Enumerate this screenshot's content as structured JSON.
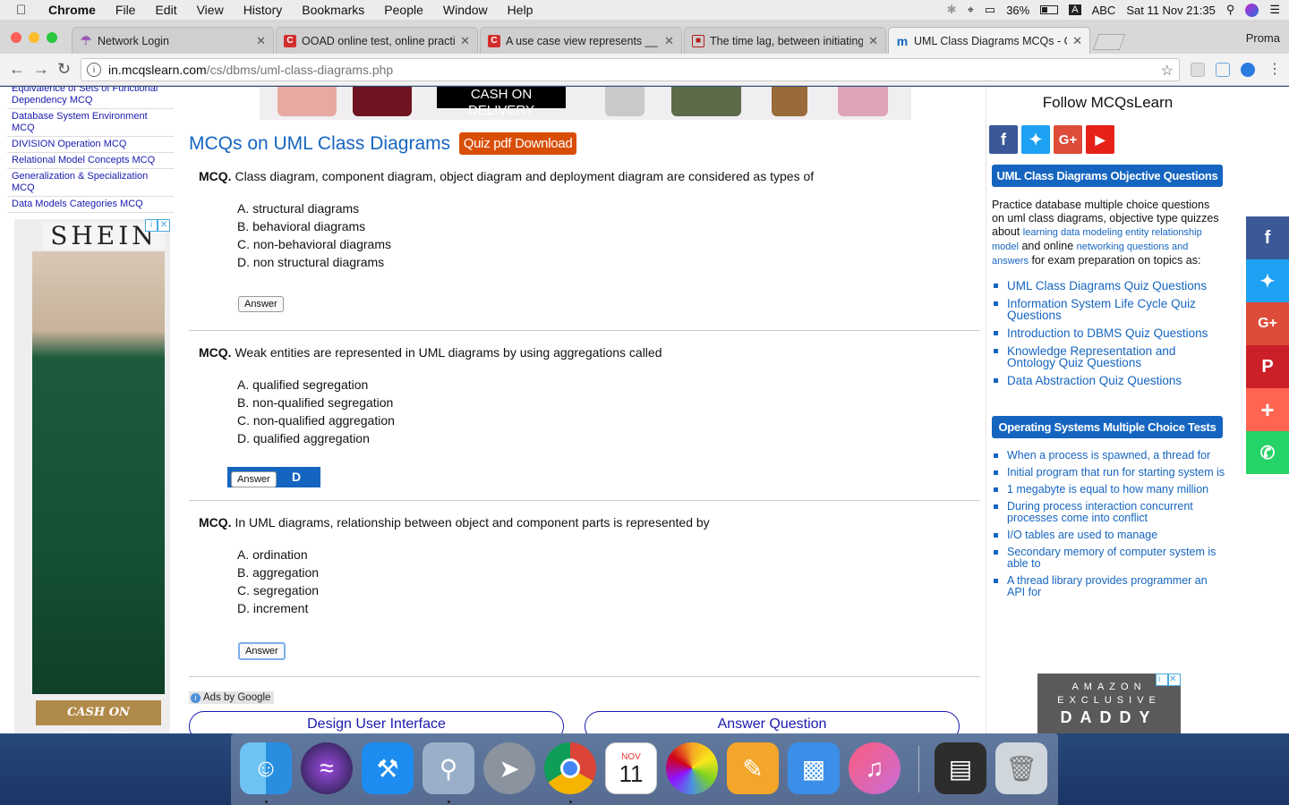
{
  "menubar": {
    "app": "Chrome",
    "items": [
      "File",
      "Edit",
      "View",
      "History",
      "Bookmarks",
      "People",
      "Window",
      "Help"
    ],
    "battery": "36%",
    "input_source": "ABC",
    "clock": "Sat 11 Nov  21:35"
  },
  "tabs": [
    {
      "title": "Network Login",
      "icon": "network-login-icon",
      "color": "#9b59b6"
    },
    {
      "title": "OOAD online test, online practi",
      "icon": "c-site-icon",
      "color": "#d32f2f"
    },
    {
      "title": "A use case view represents __",
      "icon": "c-site-icon",
      "color": "#d32f2f"
    },
    {
      "title": "The time lag, between initiating",
      "icon": "image-site-icon",
      "color": "#b71c1c"
    },
    {
      "title": "UML Class Diagrams MCQs - C",
      "icon": "mcqslearn-icon",
      "color": "#1565c0"
    }
  ],
  "profile": "Proma",
  "address": {
    "host": "in.mcqslearn.com",
    "path": "/cs/dbms/uml-class-diagrams.php"
  },
  "left_links": [
    "Equivalence of Sets of Functional Dependency MCQ",
    "Database System Environment MCQ",
    "DIVISION Operation MCQ",
    "Relational Model Concepts MCQ",
    "Generalization & Specialization MCQ",
    "Data Models Categories MCQ"
  ],
  "left_ad": {
    "brand": "SHEIN",
    "tagline": "CASH ON DELIVERY"
  },
  "top_ad": {
    "tagline": "CASH ON DELIVERY"
  },
  "main": {
    "title": "MCQs on UML Class Diagrams",
    "pdf_button": "Quiz pdf Download",
    "mcq_prefix": "MCQ.",
    "answer_label": "Answer",
    "questions": [
      {
        "text": "Class diagram, component diagram, object diagram and deployment diagram are considered as types of",
        "options": [
          "A. structural diagrams",
          "B. behavioral diagrams",
          "C. non-behavioral diagrams",
          "D. non structural diagrams"
        ],
        "revealed": ""
      },
      {
        "text": "Weak entities are represented in UML diagrams by using aggregations called",
        "options": [
          "A. qualified segregation",
          "B. non-qualified segregation",
          "C. non-qualified aggregation",
          "D. qualified aggregation"
        ],
        "revealed": "D"
      },
      {
        "text": "In UML diagrams, relationship between object and component parts is represented by",
        "options": [
          "A. ordination",
          "B. aggregation",
          "C. segregation",
          "D. increment"
        ],
        "revealed": ""
      }
    ],
    "ads_by": "Ads by Google",
    "pill_left": "Design User Interface",
    "pill_right": "Answer Question"
  },
  "right": {
    "follow": "Follow MCQsLearn",
    "head1": "UML Class Diagrams Objective Questions",
    "intro_a": "Practice database multiple choice questions on uml class diagrams, objective type quizzes about",
    "intro_link1": "learning data modeling entity relationship model",
    "intro_b": "and online",
    "intro_link2": "networking questions and answers",
    "intro_c": "for exam preparation on topics as:",
    "topics": [
      "UML Class Diagrams Quiz Questions",
      "Information System Life Cycle Quiz Questions",
      "Introduction to DBMS Quiz Questions",
      "Knowledge Representation and Ontology Quiz Questions",
      "Data Abstraction Quiz Questions"
    ],
    "head2": "Operating Systems Multiple Choice Tests",
    "os_links": [
      "When a process is spawned, a thread for",
      "Initial program that run for starting system is",
      "1 megabyte is equal to how many million",
      "During process interaction concurrent processes come into conflict",
      "I/O tables are used to manage",
      "Secondary memory of computer system is able to",
      "A thread library provides programmer an API for"
    ],
    "amazon_top": "AMAZON",
    "amazon_mid": "EXCLUSIVE",
    "amazon_bottom": "DADDY"
  },
  "dock": {
    "calendar_month": "NOV",
    "calendar_day": "11"
  }
}
